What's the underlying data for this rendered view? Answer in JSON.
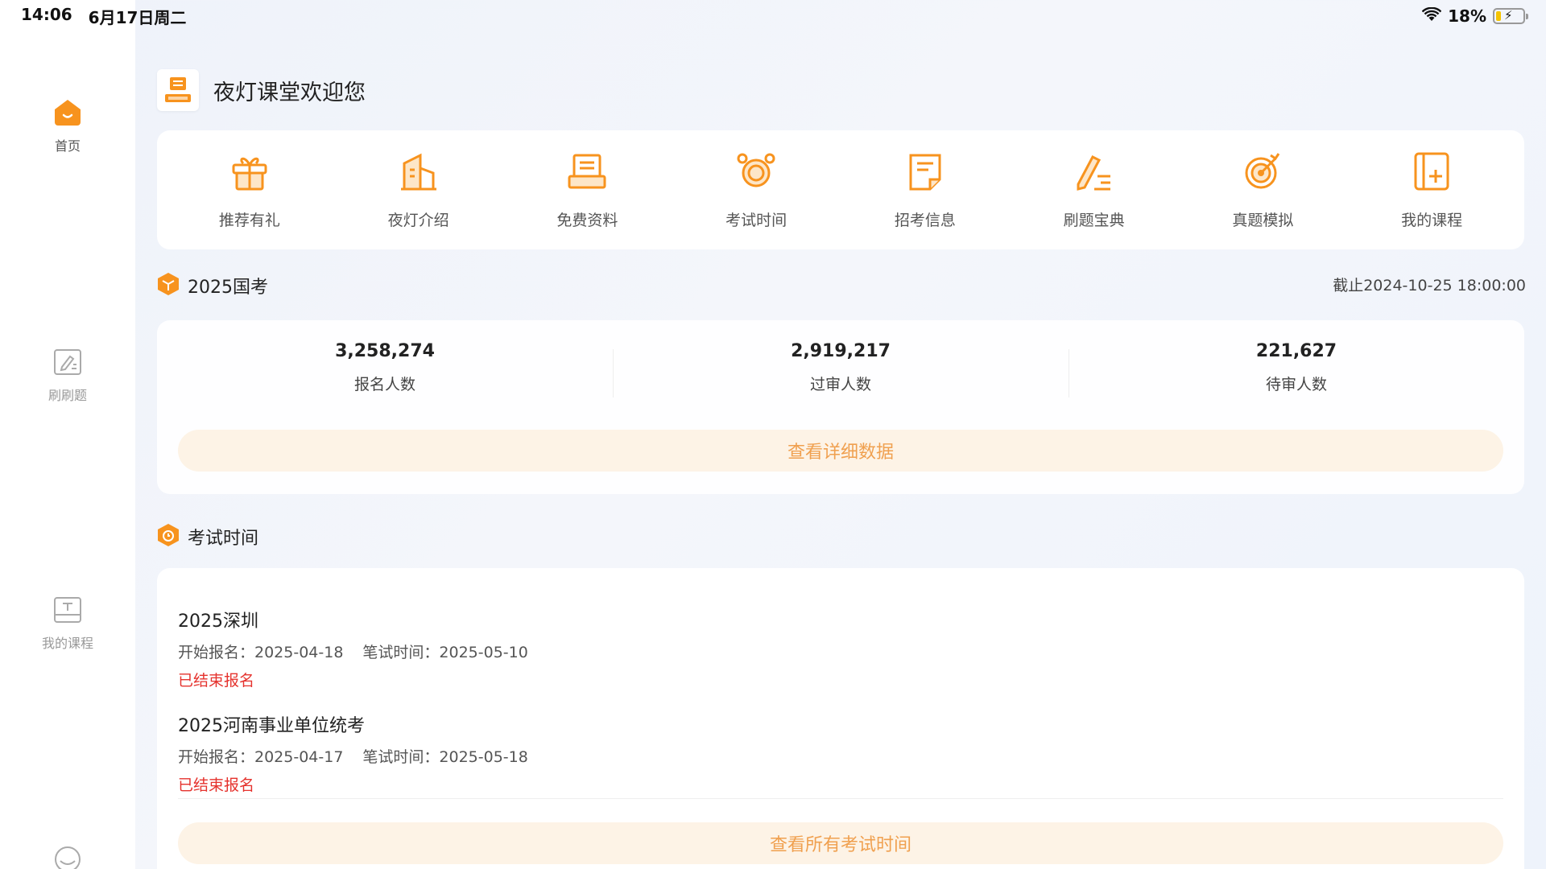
{
  "status_bar": {
    "time": "14:06",
    "date": "6月17日周二",
    "battery": "18%",
    "battery_level": 0.18
  },
  "sidebar": {
    "items": [
      {
        "label": "首页",
        "icon": "home-icon",
        "active": true
      },
      {
        "label": "刷刷题",
        "icon": "edit-note-icon",
        "active": false
      },
      {
        "label": "我的课程",
        "icon": "course-board-icon",
        "active": false
      },
      {
        "label": "",
        "icon": "loading-icon",
        "active": false
      }
    ]
  },
  "header": {
    "title": "夜灯课堂欢迎您",
    "logo_icon": "book-logo-icon"
  },
  "quick_menu": [
    {
      "label": "推荐有礼",
      "icon": "gift-icon"
    },
    {
      "label": "夜灯介绍",
      "icon": "building-icon"
    },
    {
      "label": "免费资料",
      "icon": "document-stack-icon"
    },
    {
      "label": "考试时间",
      "icon": "alarm-clock-icon"
    },
    {
      "label": "招考信息",
      "icon": "notice-icon"
    },
    {
      "label": "刷题宝典",
      "icon": "pen-list-icon"
    },
    {
      "label": "真题模拟",
      "icon": "target-icon"
    },
    {
      "label": "我的课程",
      "icon": "course-add-icon"
    }
  ],
  "national_exam": {
    "title": "2025国考",
    "deadline": "截止2024-10-25 18:00:00",
    "stats": [
      {
        "value": "3,258,274",
        "label": "报名人数"
      },
      {
        "value": "2,919,217",
        "label": "过审人数"
      },
      {
        "value": "221,627",
        "label": "待审人数"
      }
    ],
    "detail_button": "查看详细数据"
  },
  "exam_time": {
    "title": "考试时间",
    "items": [
      {
        "name": "2025深圳",
        "start": "开始报名：2025-04-18",
        "written": "笔试时间：2025-05-10",
        "status": "已结束报名"
      },
      {
        "name": "2025河南事业单位统考",
        "start": "开始报名：2025-04-17",
        "written": "笔试时间：2025-05-18",
        "status": "已结束报名"
      }
    ],
    "all_button": "查看所有考试时间"
  },
  "colors": {
    "accent": "#f7931e",
    "accent_light": "#fdf3e6",
    "danger": "#e5322d"
  }
}
